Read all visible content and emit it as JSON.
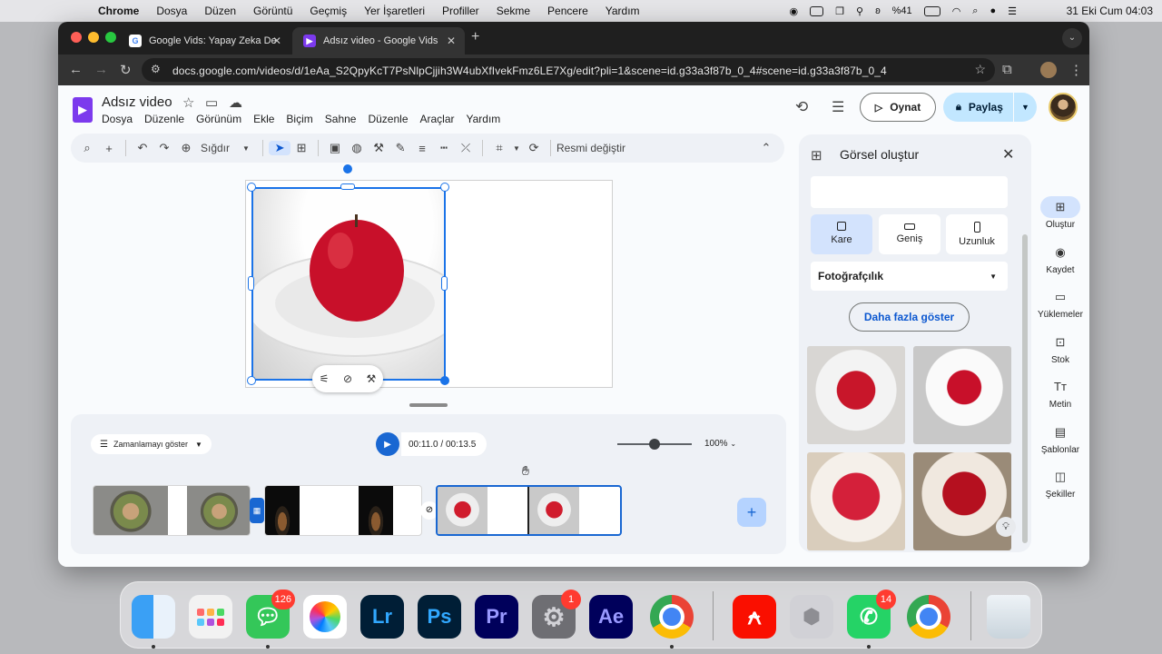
{
  "menubar": {
    "apple": "",
    "items": [
      "Chrome",
      "Dosya",
      "Düzen",
      "Görüntü",
      "Geçmiş",
      "Yer İşaretleri",
      "Profiller",
      "Sekme",
      "Pencere",
      "Yardım"
    ],
    "battery": "%41",
    "clock": "31 Eki Cum  04:03"
  },
  "browser": {
    "tabs": [
      {
        "title": "Google Vids: Yapay Zeka Des",
        "active": false
      },
      {
        "title": "Adsız video - Google Vids",
        "active": true
      }
    ],
    "url": "docs.google.com/videos/d/1eAa_S2QpyKcT7PsNlpCjjih3W4ubXfIvekFmz6LE7Xg/edit?pli=1&scene=id.g33a3f87b_0_4#scene=id.g33a3f87b_0_4"
  },
  "app": {
    "title": "Adsız video",
    "menu": [
      "Dosya",
      "Düzenle",
      "Görünüm",
      "Ekle",
      "Biçim",
      "Sahne",
      "Düzenle",
      "Araçlar",
      "Yardım"
    ],
    "play_label": "Oynat",
    "share_label": "Paylaş"
  },
  "toolbar": {
    "zoom_label": "Sığdır",
    "replace_image_label": "Resmi değiştir"
  },
  "timeline": {
    "show_timing_label": "Zamanlamayı göster",
    "timecode": "00:11.0 / 00:13.5",
    "zoom_percent": "100%",
    "zoom_level": 0.5
  },
  "panel": {
    "title": "Görsel oluştur",
    "shapes": [
      {
        "label": "Kare",
        "selected": true
      },
      {
        "label": "Geniş",
        "selected": false
      },
      {
        "label": "Uzunluk",
        "selected": false
      }
    ],
    "style_value": "Fotoğrafçılık",
    "more_label": "Daha fazla göster"
  },
  "rail": [
    {
      "label": "Oluştur",
      "icon": "create-image-icon",
      "selected": true
    },
    {
      "label": "Kaydet",
      "icon": "record-icon",
      "selected": false
    },
    {
      "label": "Yüklemeler",
      "icon": "folder-icon",
      "selected": false
    },
    {
      "label": "Stok",
      "icon": "stock-icon",
      "selected": false
    },
    {
      "label": "Metin",
      "icon": "text-icon",
      "selected": false
    },
    {
      "label": "Şablonlar",
      "icon": "template-icon",
      "selected": false
    },
    {
      "label": "Şekiller",
      "icon": "shapes-icon",
      "selected": false
    }
  ],
  "dock": {
    "messages_badge": "126",
    "settings_badge": "1",
    "whatsapp_badge": "14",
    "lr": "Lr",
    "ps": "Ps",
    "pr": "Pr",
    "ae": "Ae"
  },
  "colors": {
    "accent": "#1a73e8",
    "share_bg": "#c2e7ff",
    "vids_logo": "#7c3aed"
  }
}
